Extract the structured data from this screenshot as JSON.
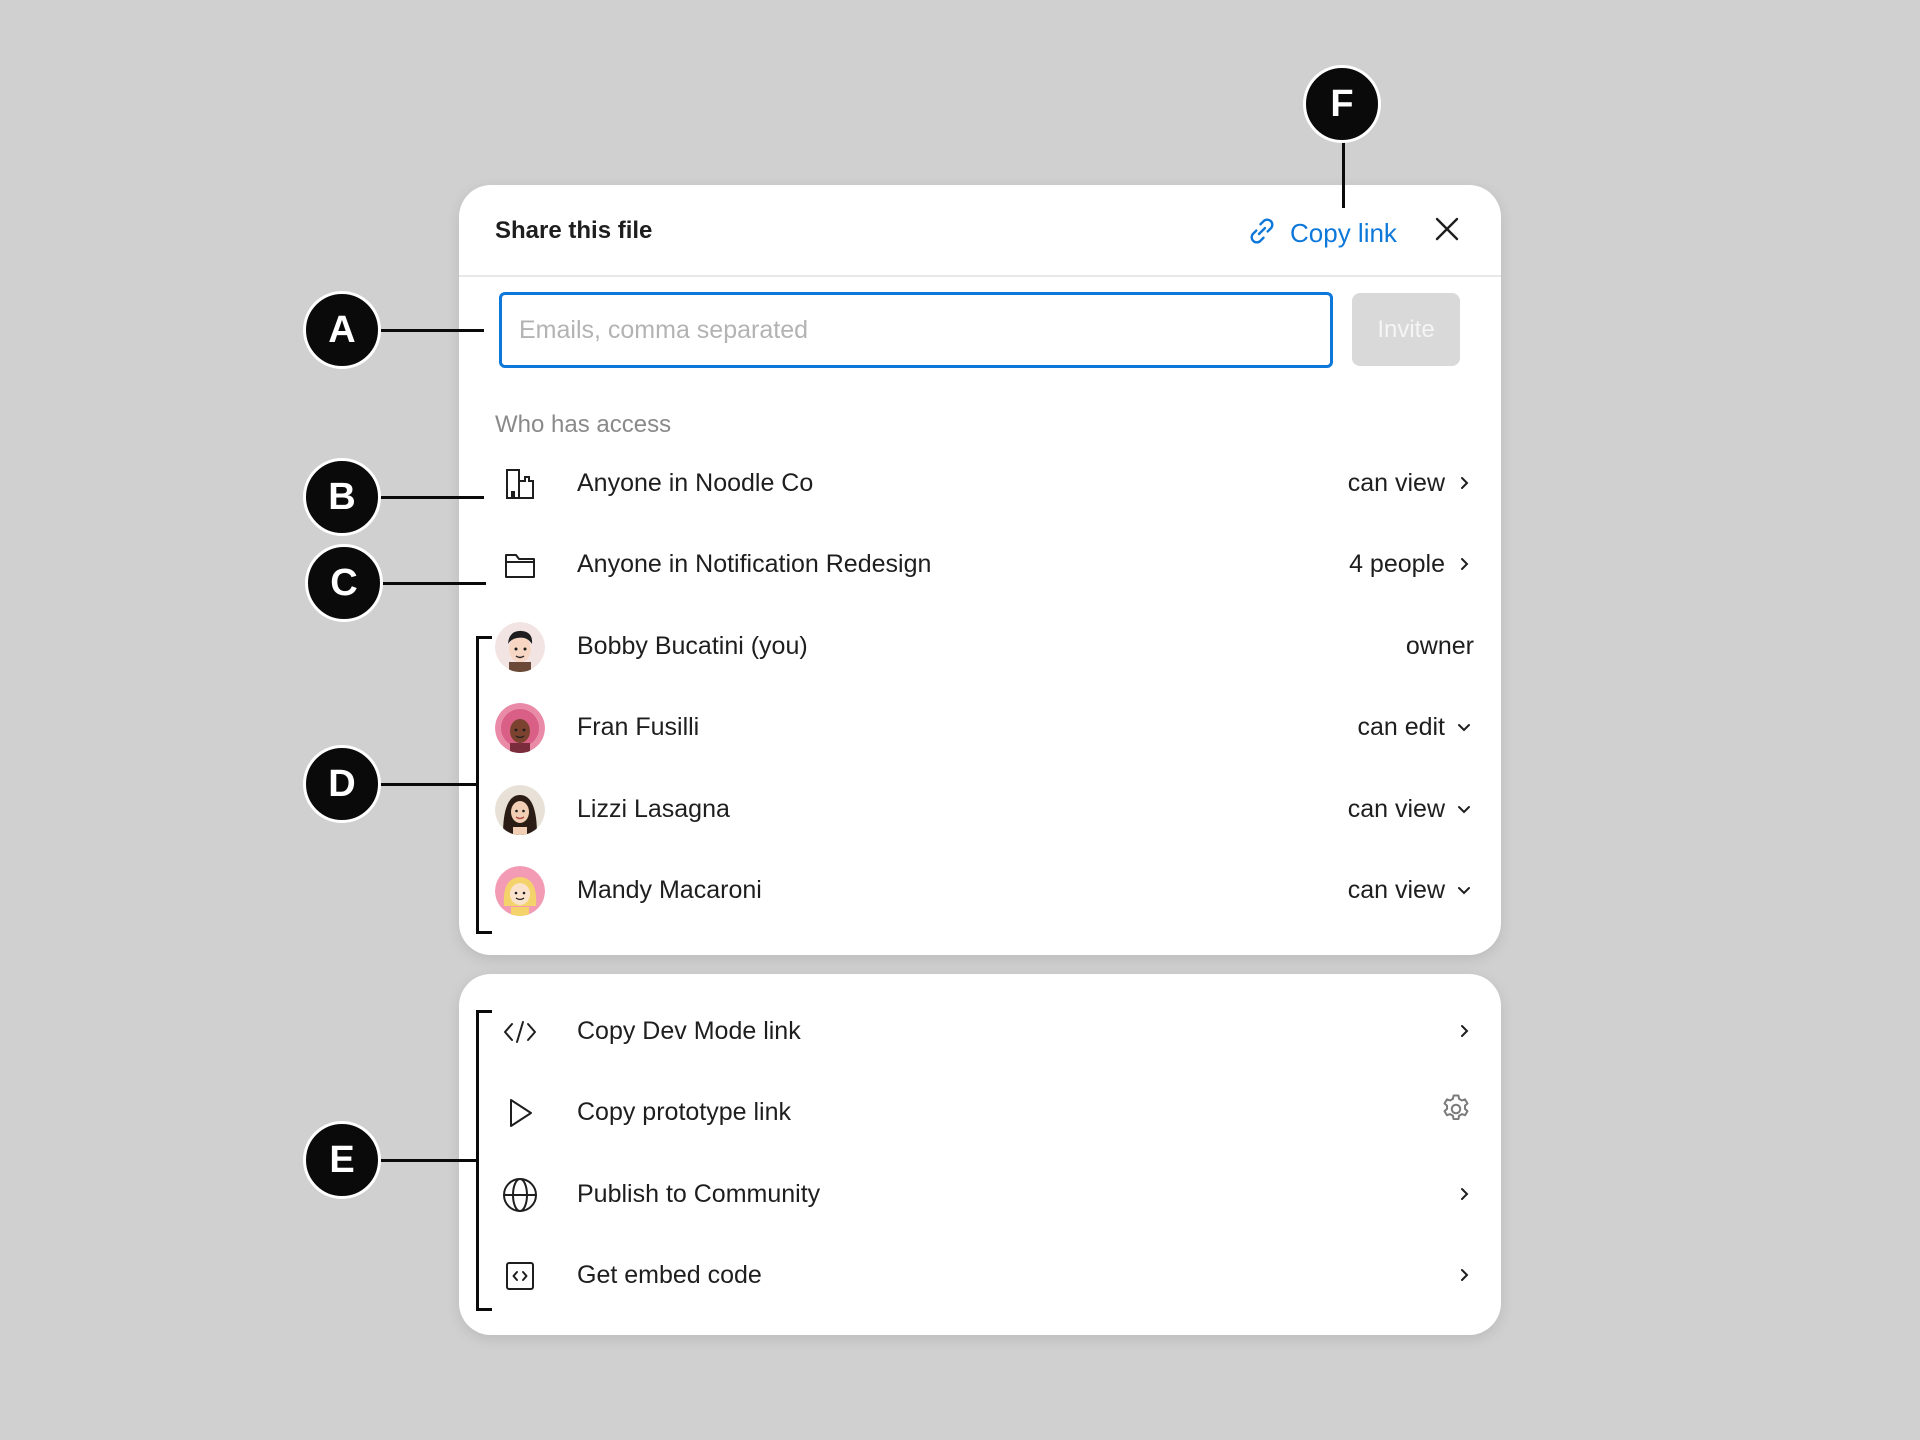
{
  "header": {
    "title": "Share this file",
    "copy_link_label": "Copy link"
  },
  "invite": {
    "placeholder": "Emails, comma separated",
    "button_label": "Invite"
  },
  "access": {
    "section_title": "Who has access",
    "groups": [
      {
        "label": "Anyone in Noodle Co",
        "permission": "can view",
        "icon": "building-icon"
      },
      {
        "label": "Anyone in Notification Redesign",
        "permission": "4 people",
        "icon": "folder-icon"
      }
    ],
    "people": [
      {
        "name": "Bobby Bucatini (you)",
        "role": "owner"
      },
      {
        "name": "Fran Fusilli",
        "role": "can edit"
      },
      {
        "name": "Lizzi Lasagna",
        "role": "can view"
      },
      {
        "name": "Mandy Macaroni",
        "role": "can view"
      }
    ]
  },
  "links": [
    {
      "label": "Copy Dev Mode link",
      "icon": "code-icon",
      "action": "chevron-right-icon"
    },
    {
      "label": "Copy prototype link",
      "icon": "play-icon",
      "action": "gear-icon"
    },
    {
      "label": "Publish to Community",
      "icon": "globe-icon",
      "action": "chevron-right-icon"
    },
    {
      "label": "Get embed code",
      "icon": "embed-icon",
      "action": "chevron-right-icon"
    }
  ],
  "annotations": {
    "a": "A",
    "b": "B",
    "c": "C",
    "d": "D",
    "e": "E",
    "f": "F"
  },
  "colors": {
    "accent": "#0d78d9",
    "background": "#d0d0d0",
    "annotation": "#0a0a0a"
  }
}
